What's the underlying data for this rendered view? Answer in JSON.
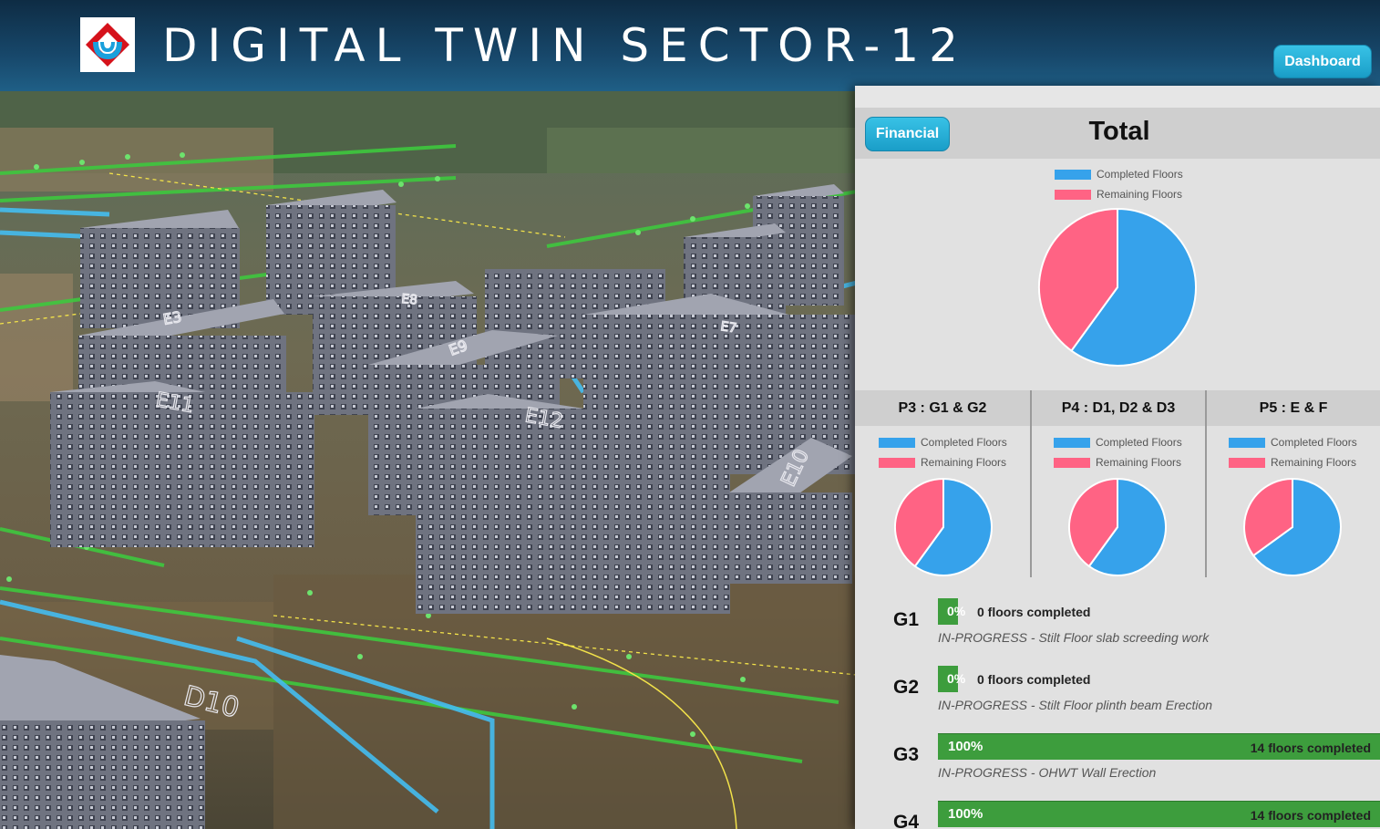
{
  "header": {
    "title": "DIGITAL TWIN SECTOR-12",
    "dashboard_label": "Dashboard"
  },
  "scene": {
    "building_labels": [
      "E11",
      "E12",
      "E10",
      "D10",
      "E8",
      "E9",
      "E7",
      "E3"
    ]
  },
  "panel": {
    "financial_label": "Financial",
    "total_title": "Total",
    "legend": {
      "completed": "Completed Floors",
      "remaining": "Remaining Floors"
    },
    "colors": {
      "completed": "#36a2eb",
      "remaining": "#ff6384",
      "progress": "#3d9d3d"
    },
    "total_completed_fraction": 0.6,
    "phases": [
      {
        "title": "P3 : G1 & G2",
        "completed_fraction": 0.6
      },
      {
        "title": "P4 : D1, D2 & D3",
        "completed_fraction": 0.6
      },
      {
        "title": "P5 : E & F",
        "completed_fraction": 0.65
      }
    ],
    "buildings": [
      {
        "name": "G1",
        "percent": "0%",
        "floors": "0 floors completed",
        "status": "IN-PROGRESS - Stilt Floor slab screeding work",
        "fraction": 0
      },
      {
        "name": "G2",
        "percent": "0%",
        "floors": "0 floors completed",
        "status": "IN-PROGRESS - Stilt Floor plinth beam Erection",
        "fraction": 0
      },
      {
        "name": "G3",
        "percent": "100%",
        "floors": "14 floors completed",
        "status": "IN-PROGRESS - OHWT Wall Erection",
        "fraction": 1
      },
      {
        "name": "G4",
        "percent": "100%",
        "floors": "14 floors completed",
        "status": "",
        "fraction": 1
      }
    ]
  }
}
